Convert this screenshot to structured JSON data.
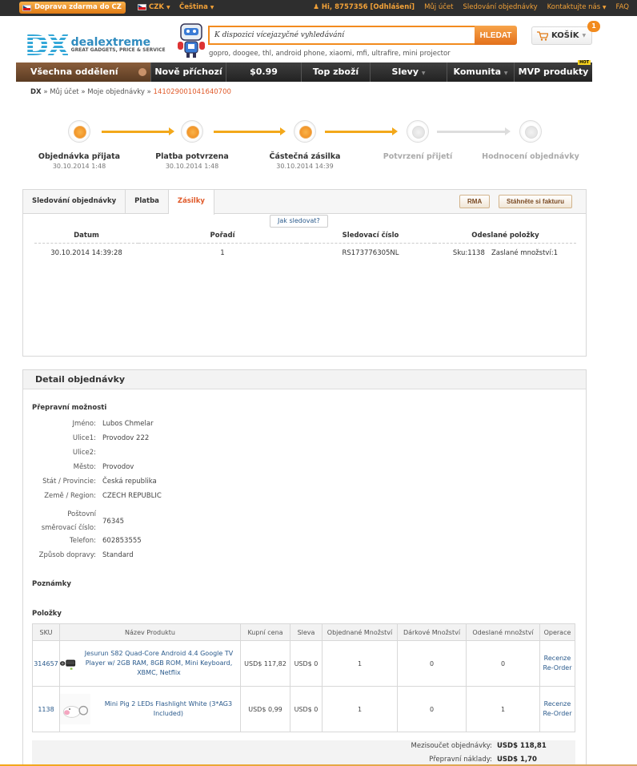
{
  "topbar": {
    "free_shipping": "Doprava zdarma do CZ",
    "currency": "CZK",
    "language": "Čeština",
    "user": "Hi, 8757356 [Odhlášení]",
    "my_account": "Můj účet",
    "order_tracking": "Sledování objednávky",
    "contact": "Kontaktujte nás",
    "faq": "FAQ"
  },
  "header": {
    "logo_text": "DX",
    "brand_name_a": "deal",
    "brand_name_b": "extreme",
    "brand_tagline": "GREAT GADGETS, PRICE & SERVICE",
    "search_value": "K dispozici vícejazyčné vyhledávání",
    "search_button": "HLEDAT",
    "hot_searches": "gopro, doogee, thl, android phone, xiaomi, mfi, ultrafire, mini projector",
    "cart_label": "KOŠÍK",
    "cart_count": "1"
  },
  "nav": {
    "all": "Všechna oddělení",
    "items": [
      "Nově příchozí",
      "$0.99",
      "Top zboží",
      "Slevy",
      "Komunita",
      "MVP produkty"
    ],
    "hot_badge": "HOT"
  },
  "breadcrumb": {
    "home": "DX",
    "sep": "»",
    "account": "Můj účet",
    "orders": "Moje objednávky",
    "order_id": "141029001041640700"
  },
  "steps": [
    {
      "label": "Objednávka přijata",
      "date": "30.10.2014 1:48",
      "active": true
    },
    {
      "label": "Platba potvrzena",
      "date": "30.10.2014 1:48",
      "active": true
    },
    {
      "label": "Částečná zásilka",
      "date": "30.10.2014 14:39",
      "active": true
    },
    {
      "label": "Potvrzení přijetí",
      "date": "",
      "active": false
    },
    {
      "label": "Hodnocení objednávky",
      "date": "",
      "active": false
    }
  ],
  "shipment": {
    "tabs": [
      "Sledování objednávky",
      "Platba",
      "Zásilky"
    ],
    "rma": "RMA",
    "invoice": "Stáhněte si fakturu",
    "track_help": "Jak sledovat?",
    "columns": [
      "Datum",
      "Pořadí",
      "Sledovací číslo",
      "Odeslané položky"
    ],
    "row": {
      "date": "30.10.2014 14:39:28",
      "order": "1",
      "tracking": "RS173776305NL",
      "items": "Sku:1138   Zaslané množství:1"
    }
  },
  "detail": {
    "title": "Detail objednávky",
    "shipping_title": "Přepravní možnosti",
    "address": [
      {
        "k": "Jméno:",
        "v": "Lubos Chmelar"
      },
      {
        "k": "Ulice1:",
        "v": "Provodov 222"
      },
      {
        "k": "Ulice2:",
        "v": ""
      },
      {
        "k": "Město:",
        "v": "Provodov"
      },
      {
        "k": "Stát / Provincie:",
        "v": "Česká republika"
      },
      {
        "k": "Země / Region:",
        "v": "CZECH REPUBLIC"
      },
      {
        "k": "Poštovní směrovací číslo:",
        "v": "76345"
      },
      {
        "k": "Telefon:",
        "v": "602853555"
      },
      {
        "k": "Způsob dopravy:",
        "v": "Standard"
      }
    ],
    "notes_title": "Poznámky",
    "items_title": "Položky",
    "columns": [
      "SKU",
      "Název Produktu",
      "Kupní cena",
      "Sleva",
      "Objednané Množství",
      "Dárkové Množství",
      "Odeslané množství",
      "Operace"
    ],
    "items": [
      {
        "sku": "314657",
        "name": "Jesurun S82 Quad-Core Android 4.4 Google TV Player w/ 2GB RAM, 8GB ROM, Mini Keyboard, XBMC, Netflix",
        "price": "USD$ 117,82",
        "discount": "USD$ 0",
        "ordered": "1",
        "gift": "0",
        "shipped": "0",
        "op1": "Recenze",
        "op2": "Re-Order"
      },
      {
        "sku": "1138",
        "name": "Mini Pig 2 LEDs Flashlight White (3*AG3 Included)",
        "price": "USD$ 0,99",
        "discount": "USD$ 0",
        "ordered": "1",
        "gift": "0",
        "shipped": "1",
        "op1": "Recenze",
        "op2": "Re-Order"
      }
    ],
    "subtotal_label": "Mezisoučet objednávky:",
    "subtotal": "USD$ 118,81",
    "shipping_label": "Přepravní náklady:",
    "shipping": "USD$ 1,70"
  }
}
